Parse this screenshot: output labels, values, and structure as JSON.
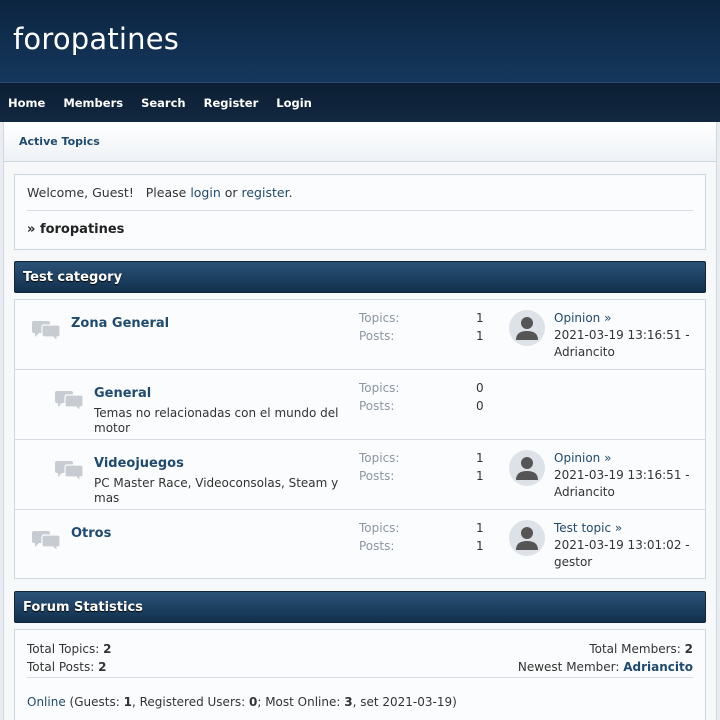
{
  "site": {
    "title": "foropatines"
  },
  "nav": [
    "Home",
    "Members",
    "Search",
    "Register",
    "Login"
  ],
  "subnav": {
    "active_topics": "Active Topics"
  },
  "welcome": {
    "prefix": "Welcome, Guest!   Please ",
    "login": "login",
    "or": " or ",
    "register": "register",
    "period": ".",
    "breadcrumb_sep": "» ",
    "breadcrumb": "foropatines"
  },
  "category": {
    "title": "Test category"
  },
  "labels": {
    "topics": "Topics:",
    "posts": "Posts:"
  },
  "forums": [
    {
      "name": "Zona General",
      "description": "",
      "topics": "1",
      "posts": "1",
      "last_topic": "Opinion »",
      "last_date": "2021-03-19 13:16:51 -",
      "last_user": "Adriancito",
      "indent": false,
      "has_last": true
    },
    {
      "name": "General",
      "description": "Temas no relacionadas con el mundo del motor",
      "topics": "0",
      "posts": "0",
      "last_topic": "",
      "last_date": "",
      "last_user": "",
      "indent": true,
      "has_last": false
    },
    {
      "name": "Videojuegos",
      "description": "PC Master Race, Videoconsolas, Steam y mas",
      "topics": "1",
      "posts": "1",
      "last_topic": "Opinion »",
      "last_date": "2021-03-19 13:16:51 -",
      "last_user": "Adriancito",
      "indent": true,
      "has_last": true
    },
    {
      "name": "Otros",
      "description": "",
      "topics": "1",
      "posts": "1",
      "last_topic": "Test topic »",
      "last_date": "2021-03-19 13:01:02 -",
      "last_user": "gestor",
      "indent": false,
      "has_last": true
    }
  ],
  "statistics": {
    "title": "Forum Statistics",
    "total_topics_label": "Total Topics:",
    "total_topics": "2",
    "total_posts_label": "Total Posts:",
    "total_posts": "2",
    "total_members_label": "Total Members:",
    "total_members": "2",
    "newest_member_label": "Newest Member:",
    "newest_member": "Adriancito",
    "online_link": "Online",
    "guests_label": " (Guests: ",
    "guests": "1",
    "registered_label": ", Registered Users: ",
    "registered": "0",
    "most_online_label": "; Most Online: ",
    "most_online": "3",
    "most_online_date": ", set 2021-03-19)"
  },
  "colors": {
    "header_bg": "#0c2540",
    "navbar_bg": "#0b1e34",
    "category_bg": "#1f4265",
    "link": "#1f4a70"
  },
  "icons": {
    "forum": "speech-bubbles-icon",
    "avatar": "user-silhouette-icon"
  }
}
